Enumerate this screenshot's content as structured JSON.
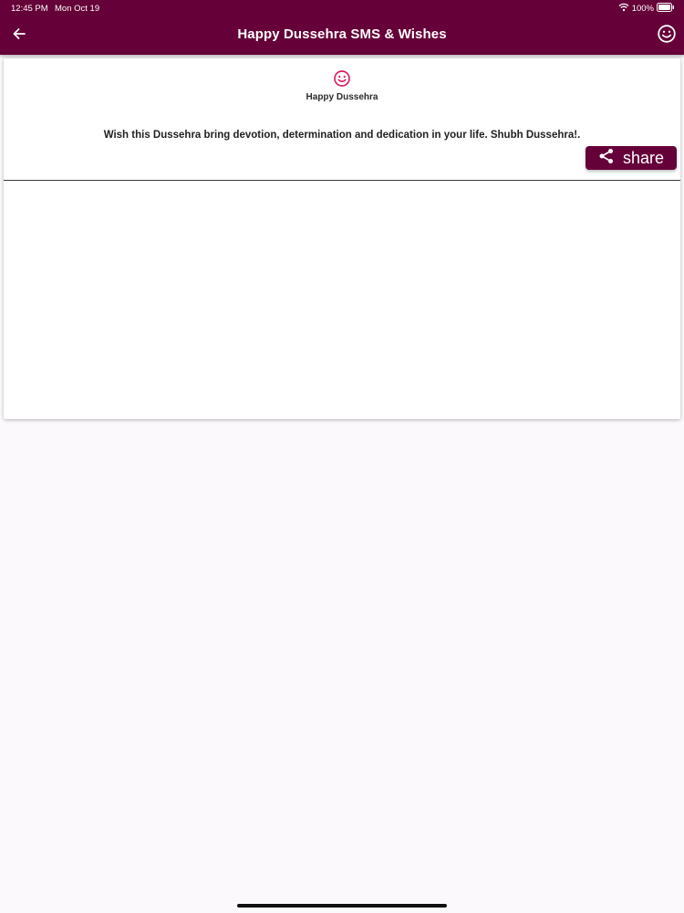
{
  "status_bar": {
    "time": "12:45 PM",
    "date": "Mon Oct 19",
    "battery": "100%",
    "icons": [
      "wifi-icon",
      "battery-icon"
    ]
  },
  "app_bar": {
    "title": "Happy Dussehra SMS & Wishes",
    "icons": [
      "back-arrow-icon",
      "smiley-icon"
    ]
  },
  "card": {
    "icon": "smiley-icon",
    "heading": "Happy Dussehra",
    "message": "Wish this Dussehra bring devotion, determination and dedication in your life. Shubh Dussehra!.",
    "share_label": "share",
    "share_icon": "share-icon"
  },
  "colors": {
    "primary": "#650038",
    "accent": "#d81b60",
    "background": "#fbf9fb",
    "card": "#ffffff"
  }
}
